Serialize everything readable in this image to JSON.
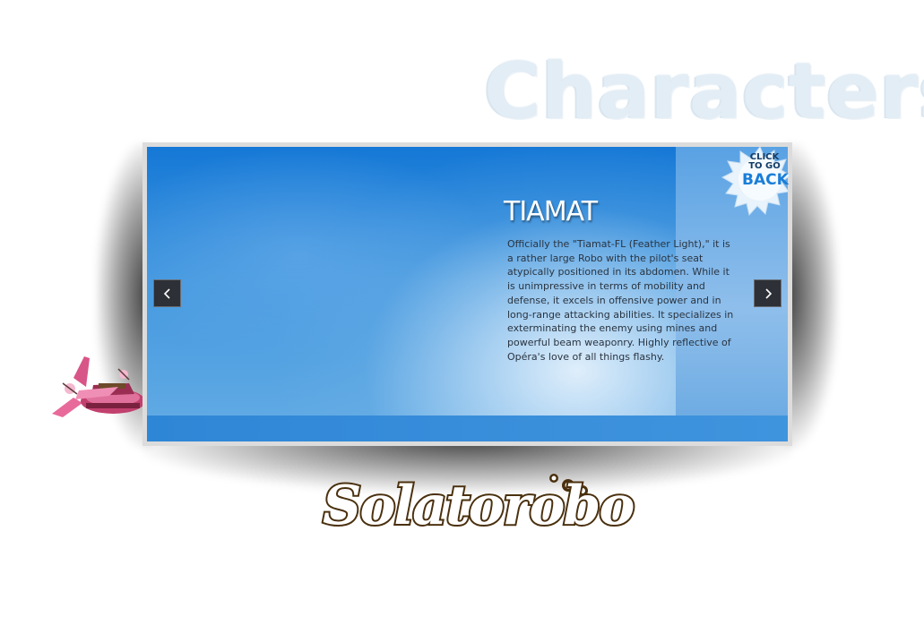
{
  "heading": "Characters",
  "back_button": {
    "line1": "CLICK",
    "line2": "TO GO",
    "line3": "BACK"
  },
  "slide": {
    "name": "TIAMAT",
    "description": "Officially the \"Tiamat-FL (Feather Light),\" it is a rather large Robo with the pilot's seat atypically positioned in its abdomen. While it is unimpressive in terms of mobility and defense, it excels in offensive power and in long-range attacking abilities. It specializes in exterminating the enemy using mines and powerful beam weaponry. Highly reflective of Opéra's love of all things flashy."
  },
  "nav": {
    "prev_icon": "chevron-left-icon",
    "next_icon": "chevron-right-icon"
  },
  "logo": {
    "text": "Solatorobo"
  },
  "colors": {
    "slide_blue": "#1a7ed8",
    "nav_button": "#2d3036",
    "logo_outline": "#4a300e",
    "heading_frost": "#e3edf5"
  }
}
